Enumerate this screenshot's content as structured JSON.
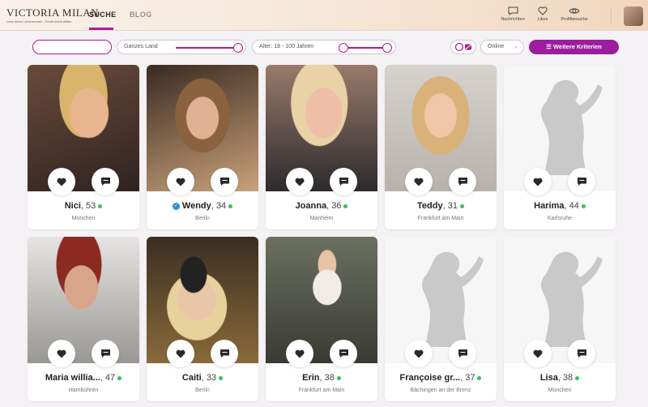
{
  "header": {
    "logo": "VICTORIA MILAN",
    "logo_tagline": "Lebe deine Leidenschaft – Finde deine Affäre",
    "tabs": [
      {
        "label": "SUCHE"
      },
      {
        "label": "BLOG"
      }
    ],
    "actions": {
      "messages": "Nachrichten",
      "likes": "Likes",
      "visits": "Profilbesuche"
    }
  },
  "filters": {
    "search_value": "",
    "region": "Ganzes Land",
    "age": "Alter: 18 - 100 Jahren",
    "status": "Online",
    "more_button": "Weitere Kriterien"
  },
  "colors": {
    "accent": "#b7178c",
    "button": "#9b1e9e",
    "online": "#3dbd5d",
    "verified": "#2e8fd8"
  },
  "profiles": [
    {
      "name": "Nici",
      "age": ", 53",
      "city": "München",
      "verified": false
    },
    {
      "name": "Wendy",
      "age": ", 34",
      "city": "Berlin",
      "verified": true
    },
    {
      "name": "Joanna",
      "age": ", 36",
      "city": "Manheim",
      "verified": false
    },
    {
      "name": "Teddy",
      "age": ", 31",
      "city": "Frankfurt am Main",
      "verified": false
    },
    {
      "name": "Harima",
      "age": ", 44",
      "city": "Karlsruhe",
      "verified": false
    },
    {
      "name": "Maria willia...",
      "age": ", 47",
      "city": "Hambühren",
      "verified": false
    },
    {
      "name": "Caiti",
      "age": ", 33",
      "city": "Berlin",
      "verified": false
    },
    {
      "name": "Erin",
      "age": ", 38",
      "city": "Frankfurt am Main",
      "verified": false
    },
    {
      "name": "Françoise gr...",
      "age": ", 37",
      "city": "Bächingen an der Brenz",
      "verified": false
    },
    {
      "name": "Lisa",
      "age": ", 38",
      "city": "München",
      "verified": false
    }
  ]
}
